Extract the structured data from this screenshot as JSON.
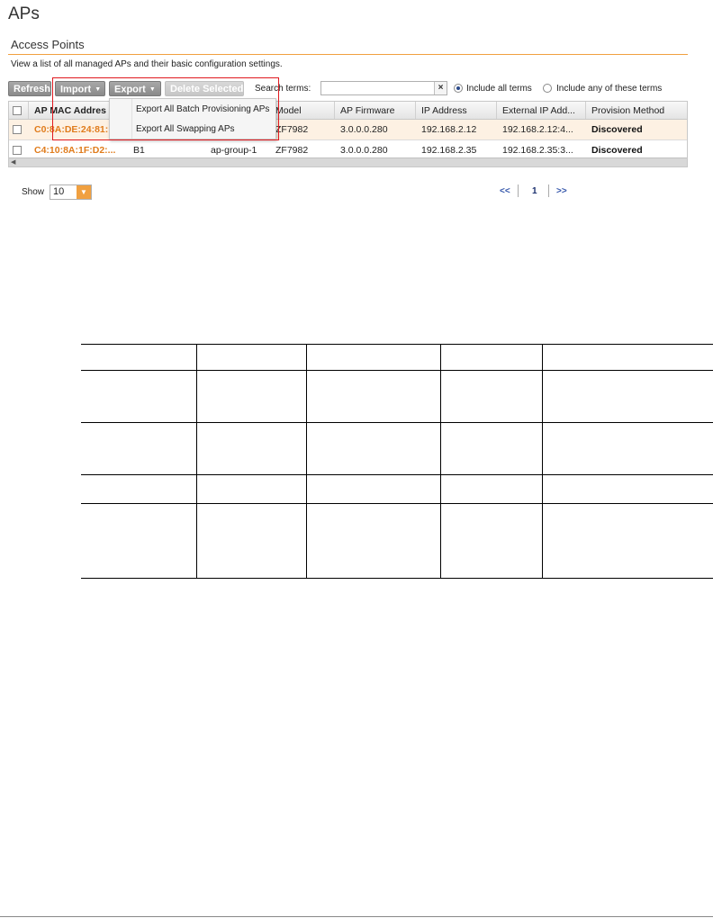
{
  "page": {
    "title": "APs"
  },
  "section": {
    "title": "Access Points",
    "description": "View a list of all managed APs and their basic configuration settings.",
    "accent_color": "#f0a040"
  },
  "toolbar": {
    "refresh": "Refresh",
    "import": "Import",
    "export": "Export",
    "delete_selected": "Delete Selected",
    "search_label": "Search terms:",
    "search_value": "",
    "clear": "×",
    "include_all": "Include all terms",
    "include_any": "Include any of these terms",
    "include_all_selected": true
  },
  "export_menu": {
    "items": [
      "Export All Batch Provisioning APs",
      "Export All Swapping APs"
    ]
  },
  "grid": {
    "columns": [
      "AP MAC Addres",
      "",
      "",
      "Model",
      "AP Firmware",
      "IP Address",
      "External IP Add...",
      "Provision Method"
    ],
    "rows": [
      {
        "mac": "C0:8A:DE:24:81:",
        "name": "",
        "group": "",
        "model": "ZF7982",
        "firmware": "3.0.0.0.280",
        "ip": "192.168.2.12",
        "external_ip": "192.168.2.12:4...",
        "provision": "Discovered",
        "highlighted": true
      },
      {
        "mac": "C4:10:8A:1F:D2:...",
        "name": "B1",
        "group": "ap-group-1",
        "model": "ZF7982",
        "firmware": "3.0.0.0.280",
        "ip": "192.168.2.35",
        "external_ip": "192.168.2.35:3...",
        "provision": "Discovered",
        "highlighted": false
      }
    ]
  },
  "footer": {
    "show_label": "Show",
    "show_value": "10",
    "pager_first": "<<",
    "pager_page": "1",
    "pager_next": ">>"
  },
  "colors": {
    "mac_text": "#e07c1c",
    "row_highlight": "#fdf1e3",
    "callout_border": "#e0191f",
    "pager": "#3355aa"
  }
}
